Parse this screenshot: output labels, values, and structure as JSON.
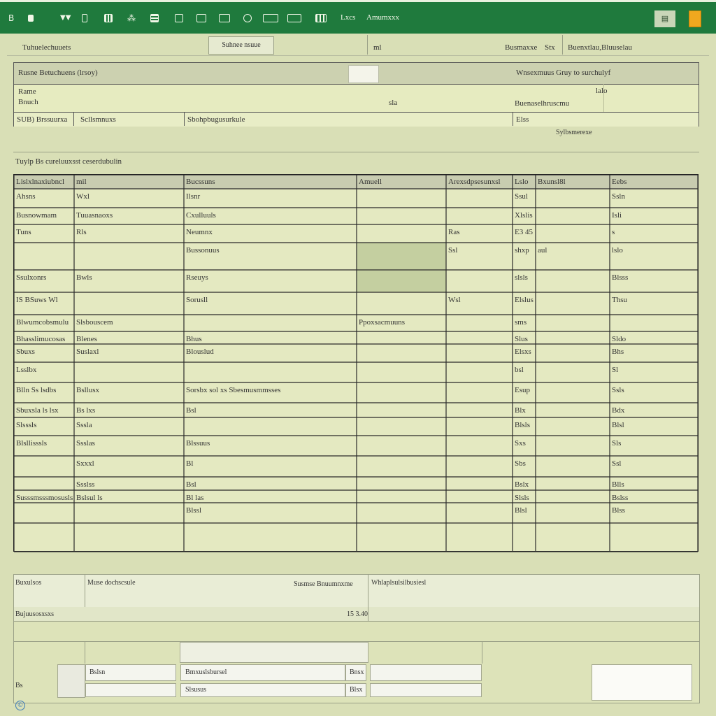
{
  "ribbon": {
    "icons": [
      {
        "name": "bold-icon",
        "glyph": "B"
      },
      {
        "name": "format-painter-icon",
        "glyph": "▪"
      },
      {
        "name": "table-icon",
        "glyph": "▦"
      },
      {
        "name": "chart-icon",
        "glyph": "▥"
      },
      {
        "name": "people-icon",
        "glyph": "👥"
      },
      {
        "name": "grid-icon",
        "glyph": "▤"
      },
      {
        "name": "clipboard-icon",
        "glyph": "▢"
      },
      {
        "name": "film-icon",
        "glyph": "▣"
      },
      {
        "name": "camera-icon",
        "glyph": "◎"
      },
      {
        "name": "screen-icon",
        "glyph": "▭"
      },
      {
        "name": "spreadsheet-icon",
        "glyph": "▦"
      }
    ],
    "labels": [
      "Lxcs",
      "Amumxxx"
    ],
    "status_box": "▤"
  },
  "toolbar": {
    "left_label": "Tuhuelechuuets",
    "tab_button": "Suhnee nsuue",
    "mid_label": "ml",
    "right_label_1": "Busmaxxe",
    "right_label_2": "Stx",
    "right_label_3": "Buenxtlau,Bluuselau"
  },
  "info": {
    "header_left": "Rusne Betuchuens (lrsoy)",
    "header_right": "Wnsexmuus Gruy to surchulyf",
    "row1_a": "Rame",
    "row1_b": "Bnuch",
    "row1_mid": "sla",
    "row1_right": "Buenaselhruscmu",
    "row1_far": "lalo",
    "row2_a": "SUB) Brssuurxa",
    "row2_b": "Scllsmnuxs",
    "row2_c": "Sbohpbugusurkule",
    "row2_d": "Elss",
    "under_right": "Sylbsmerexe"
  },
  "section_title": "Tuylp Bs cureluuxsst ceserdubulin",
  "table": {
    "headers": [
      "Lislxlnaxiubncl",
      "mil",
      "Bucssuns",
      "Amuell",
      "Arexsdpsesunxsl",
      "Lslo",
      "Bxunsl8l",
      "Eebs"
    ],
    "rows": [
      [
        "Ahsns",
        "Wxl",
        "Ilsnr",
        "",
        "",
        "Ssul",
        "",
        "Ssln"
      ],
      [
        "Busnowmam",
        "Tuuasnaoxs",
        "Cxulluuls",
        "",
        "",
        "Xlslis",
        "",
        "Isli"
      ],
      [
        "Tuns",
        "Rls",
        "Neumnx",
        "",
        "Ras",
        "E3 45",
        "",
        "s"
      ],
      [
        "",
        "",
        "Bussonuus",
        "",
        "Ssl",
        "shxp",
        "aul",
        "lslo"
      ],
      [
        "Ssulxonrs",
        "Bwls",
        "Rseuys",
        "",
        "",
        "slsls",
        "",
        "Blsss"
      ],
      [
        "IS BSuws Wl",
        "",
        "Sorusll",
        "",
        "Wsl",
        "Elslus",
        "",
        "Thsu"
      ],
      [
        "Blwumcobsmulu",
        "Slsbouscem",
        "",
        "Ppoxsacmuuns",
        "",
        "sms",
        "",
        ""
      ],
      [
        "Bhasslimucosas",
        "Blenes",
        "Bhus",
        "",
        "",
        "Slus",
        "",
        "Sldo"
      ],
      [
        "Sbuxs",
        "Suslaxl",
        "Blouslud",
        "",
        "",
        "Elsxs",
        "",
        "Bhs"
      ],
      [
        "Lsslbx",
        "",
        "",
        "",
        "",
        "bsl",
        "",
        "Sl"
      ],
      [
        "Blln Ss lsdbs",
        "Bsllusx",
        "Sorsbx sol xs Sbesmusmmsses",
        "",
        "",
        "Esup",
        "",
        "Ssls"
      ],
      [
        "Sbuxsla ls lsx",
        "Bs lxs",
        "Bsl",
        "",
        "",
        "Blx",
        "",
        "Bdx"
      ],
      [
        "Slsssls",
        "Sssla",
        "",
        "",
        "",
        "Blsls",
        "",
        "Blsl"
      ],
      [
        "Blsllisssls",
        "Ssslas",
        "Blssuus",
        "",
        "",
        "Sxs",
        "",
        "Sls"
      ],
      [
        "",
        "Sxxxl",
        "Bl",
        "",
        "",
        "Sbs",
        "",
        "Ssl"
      ],
      [
        "",
        "Ssslss",
        "Bsl",
        "",
        "",
        "Bslx",
        "",
        "Blls"
      ],
      [
        "Susssmsssmosusls",
        "Bslsul ls",
        "Bl las",
        "",
        "",
        "Slsls",
        "",
        "Bslss"
      ],
      [
        "",
        "",
        "Blssl",
        "",
        "",
        "Blsl",
        "",
        "Blss"
      ]
    ]
  },
  "bottom": {
    "label_a": "Buxulsos",
    "label_b": "Muse dochscsule",
    "label_c": "Susmse Bnuumnxme",
    "label_d": "Whlaplsulsilbusiesl",
    "total_label": "Bujuusosxsxs",
    "total_value": "15 3.40",
    "field_1_label": "Bslsn",
    "field_1_value": "Bmxuslsbursel",
    "field_1_tail": "Bnsx",
    "field_2_value": "Slsusus",
    "field_2_tail": "Blsx",
    "corner_label": "Bs"
  },
  "footer": {
    "copyright": "©"
  }
}
